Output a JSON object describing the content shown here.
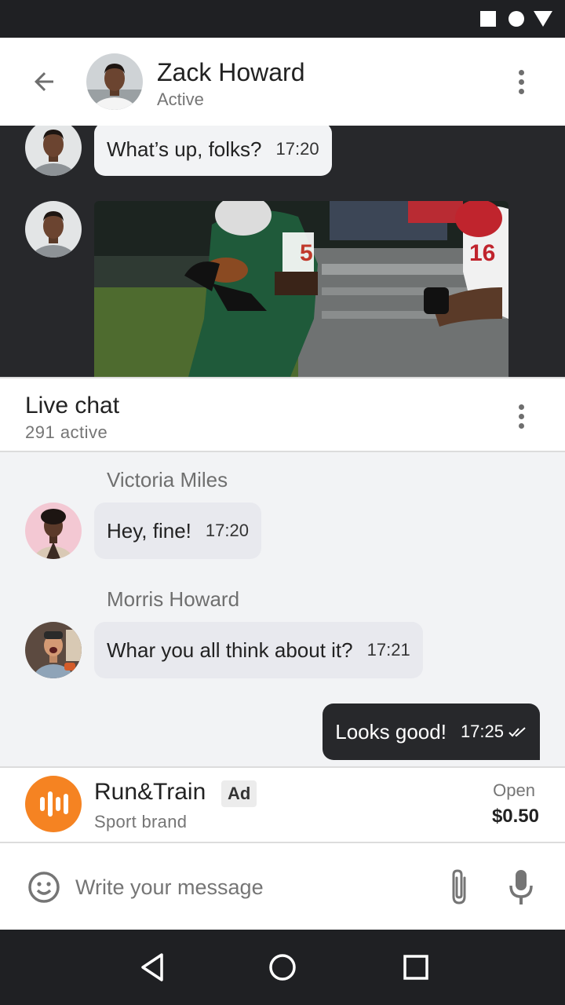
{
  "header": {
    "name": "Zack Howard",
    "status": "Active"
  },
  "video": {
    "message_text": "What’s up, folks?",
    "message_time": "17:20"
  },
  "live_chat": {
    "title": "Live chat",
    "active_count": "291 active"
  },
  "messages": [
    {
      "sender": "Victoria Miles",
      "text": "Hey, fine!",
      "time": "17:20"
    },
    {
      "sender": "Morris Howard",
      "text": "Whar you all think about it?",
      "time": "17:21"
    },
    {
      "text": "Looks good!",
      "time": "17:25",
      "outgoing": true
    }
  ],
  "ad": {
    "brand": "Run&Train",
    "badge": "Ad",
    "subtitle": "Sport brand",
    "action": "Open",
    "price": "$0.50",
    "logo_color": "#f58322"
  },
  "composer": {
    "placeholder": "Write your message"
  },
  "icons": {
    "back": "arrow-left-icon",
    "more": "more-vertical-icon",
    "emoji": "smiley-icon",
    "attach": "paperclip-icon",
    "mic": "microphone-icon",
    "read": "double-check-icon",
    "nav": [
      "back-triangle-icon",
      "home-circle-icon",
      "recents-square-icon"
    ]
  },
  "colors": {
    "dark": "#27282b",
    "bubble_in": "#e8e9ee",
    "background": "#f2f3f5"
  }
}
